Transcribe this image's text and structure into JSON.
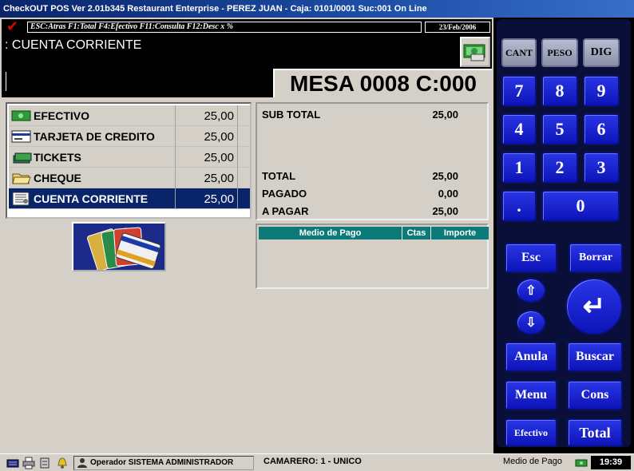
{
  "window": {
    "title": "CheckOUT POS Ver 2.01b345 Restaurant Enterprise - PEREZ JUAN - Caja: 0101/0001 Suc:001  On Line"
  },
  "hints": {
    "text": "ESC:Atras F1:Total F4:Efectivo F11:Consulta F12:Desc x %",
    "date": "23/Feb/2006"
  },
  "mode": {
    "label": ": CUENTA CORRIENTE"
  },
  "mesa": {
    "label": "MESA 0008 C:000"
  },
  "payment_methods": [
    {
      "label": "EFECTIVO",
      "amount": "25,00",
      "icon": "cash-icon"
    },
    {
      "label": "TARJETA DE CREDITO",
      "amount": "25,00",
      "icon": "credit-card-icon"
    },
    {
      "label": "TICKETS",
      "amount": "25,00",
      "icon": "tickets-icon"
    },
    {
      "label": "CHEQUE",
      "amount": "25,00",
      "icon": "folder-icon"
    },
    {
      "label": "CUENTA CORRIENTE",
      "amount": "25,00",
      "icon": "account-icon",
      "selected": true
    }
  ],
  "totals": {
    "subtotal_label": "SUB TOTAL",
    "subtotal": "25,00",
    "total_label": "TOTAL",
    "total": "25,00",
    "pagado_label": "PAGADO",
    "pagado": "0,00",
    "apagar_label": "A PAGAR",
    "apagar": "25,00"
  },
  "grid": {
    "columns": [
      "Medio de Pago",
      "Ctas",
      "Importe"
    ]
  },
  "keypad": {
    "cant": "CANT",
    "peso": "PESO",
    "dig": "DIG",
    "k7": "7",
    "k8": "8",
    "k9": "9",
    "k4": "4",
    "k5": "5",
    "k6": "6",
    "k1": "1",
    "k2": "2",
    "k3": "3",
    "dot": ".",
    "k0": "0",
    "esc": "Esc",
    "borrar": "Borrar",
    "anula": "Anula",
    "buscar": "Buscar",
    "menu": "Menu",
    "cons": "Cons",
    "efectivo": "Efectivo",
    "total": "Total"
  },
  "status": {
    "operador": "Operador  SISTEMA ADMINISTRADOR",
    "camarero": "CAMARERO: 1 -  UNICO",
    "medio": "Medio de Pago",
    "clock": "19:39"
  },
  "colors": {
    "selection": "#0a246a",
    "keypad_blue": "#1420d0",
    "grid_header": "#0d7a7a"
  }
}
